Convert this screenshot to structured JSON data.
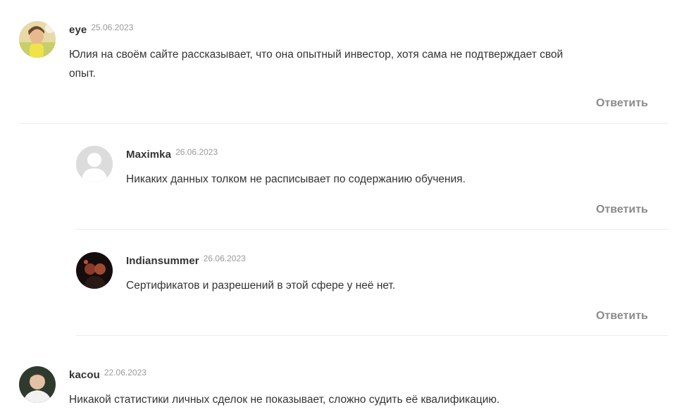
{
  "comments": [
    {
      "author": "eye",
      "date": "25.06.2023",
      "text": "Юлия на своём сайте рассказывает, что она опытный инвестор, хотя сама не подтверждает свой опыт.",
      "reply_label": "Ответить",
      "avatar_icon": "user-photo-avatar"
    },
    {
      "author": "Maximka",
      "date": "26.06.2023",
      "text": "Никаких данных толком не расписывает по содержанию обучения.",
      "reply_label": "Ответить",
      "avatar_icon": "default-user-avatar"
    },
    {
      "author": "Indiansummer",
      "date": "26.06.2023",
      "text": "Сертификатов и разрешений в этой сфере у неё нет.",
      "reply_label": "Ответить",
      "avatar_icon": "user-photo-avatar"
    },
    {
      "author": "kacou",
      "date": "22.06.2023",
      "text": "Никакой статистики личных сделок не показывает, сложно судить её квалификацию.",
      "avatar_icon": "user-photo-avatar"
    }
  ],
  "colors": {
    "text": "#333333",
    "date": "#9a9a9a",
    "reply": "#8a8a8a",
    "divider": "#ececec"
  }
}
